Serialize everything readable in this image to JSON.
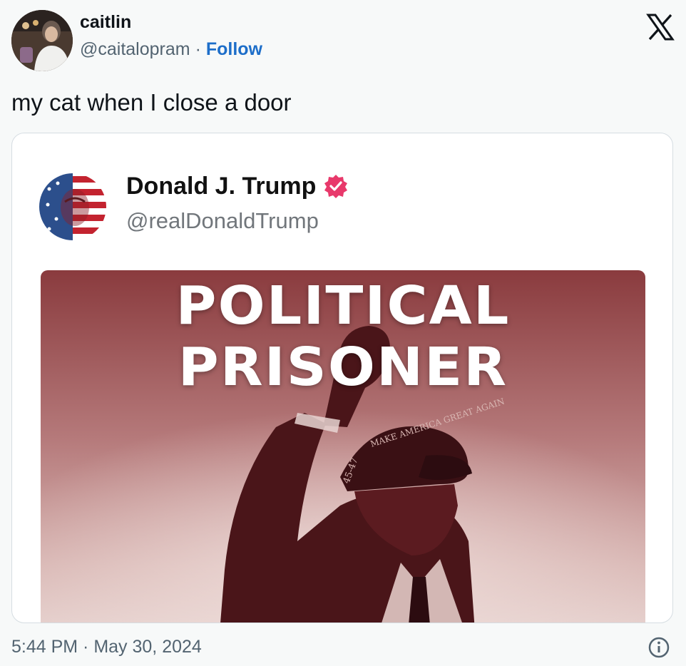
{
  "author": {
    "display_name": "caitlin",
    "handle": "@caitalopram",
    "separator": "·",
    "follow_label": "Follow"
  },
  "tweet": {
    "text": "my cat when I close a door",
    "timestamp": "5:44 PM · May 30, 2024"
  },
  "quoted": {
    "display_name": "Donald J. Trump",
    "handle": "@realDonaldTrump",
    "poster_line_1": "POLITICAL",
    "poster_line_2": "PRISONER",
    "hat_text": "MAKE AMERICA GREAT AGAIN",
    "hat_side_text": "45-47"
  },
  "icons": {
    "brand": "x-logo-icon",
    "verified": "verified-badge-icon",
    "info": "info-icon"
  },
  "colors": {
    "follow": "#1d6ec9",
    "verified_badge": "#e8396b",
    "poster_tint": "#8a3b3e"
  }
}
